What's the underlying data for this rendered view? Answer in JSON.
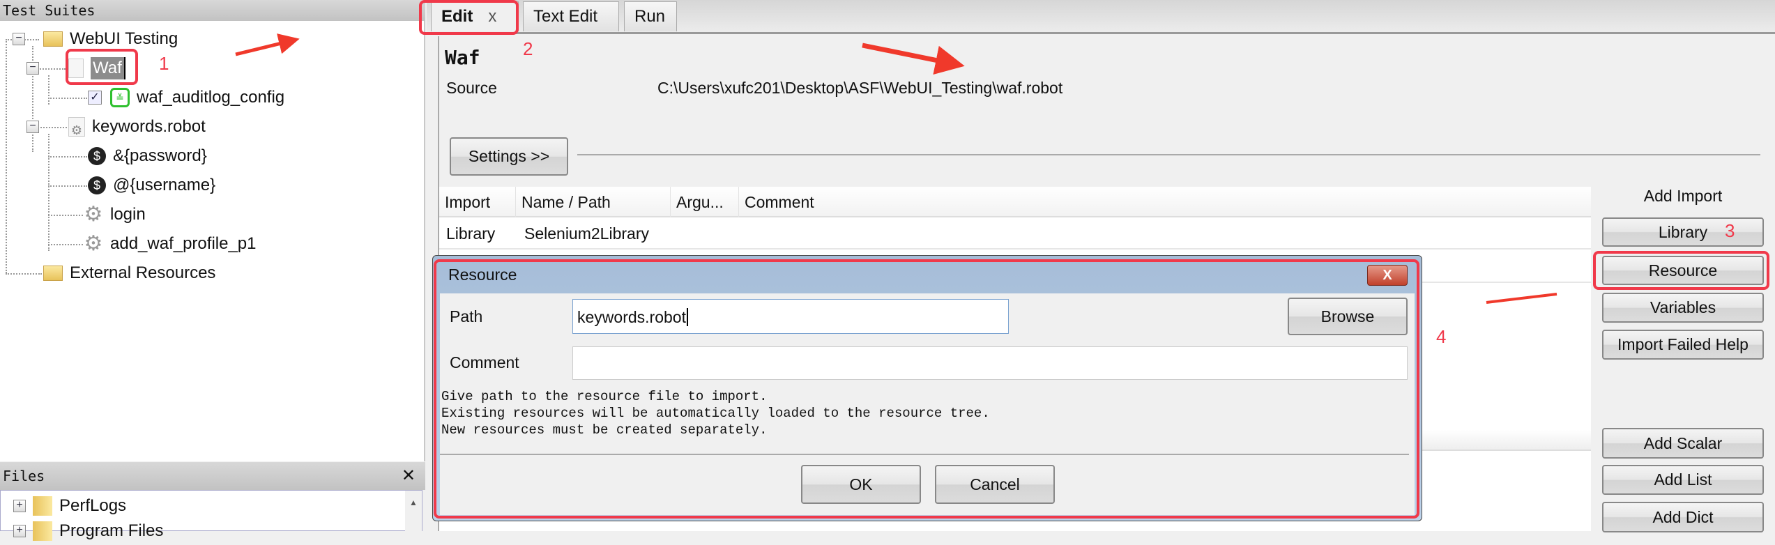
{
  "left_panel": {
    "title": "Test Suites",
    "tree": [
      {
        "label": "WebUI Testing",
        "icon": "folder-icon"
      },
      {
        "label": "Waf",
        "icon": "file-icon",
        "selected": true
      },
      {
        "label": "waf_auditlog_config",
        "icon": "robot-test-icon",
        "checked": true
      },
      {
        "label": "keywords.robot",
        "icon": "resource-file-icon"
      },
      {
        "label": "&{password}",
        "icon": "variable-icon"
      },
      {
        "label": "@{username}",
        "icon": "variable-icon"
      },
      {
        "label": "login",
        "icon": "gear-icon"
      },
      {
        "label": "add_waf_profile_p1",
        "icon": "gear-icon"
      },
      {
        "label": "External Resources",
        "icon": "external-folder-icon"
      }
    ],
    "files": {
      "title": "Files",
      "close": "✕",
      "items": [
        "PerfLogs",
        "Program Files"
      ]
    }
  },
  "tabs": [
    {
      "label": "Edit",
      "close": "x",
      "active": true
    },
    {
      "label": "Text Edit"
    },
    {
      "label": "Run"
    }
  ],
  "editor": {
    "title": "Waf",
    "source_label": "Source",
    "source_path": "C:\\Users\\xufc201\\Desktop\\ASF\\WebUI_Testing\\waf.robot",
    "settings_button": "Settings >>",
    "import_table": {
      "columns": [
        "Import",
        "Name / Path",
        "Argu...",
        "Comment"
      ],
      "rows": [
        [
          "Library",
          "Selenium2Library",
          "",
          ""
        ]
      ]
    },
    "side_buttons": {
      "add_import_label": "Add Import",
      "library": "Library",
      "resource": "Resource",
      "variables": "Variables",
      "import_failed_help": "Import Failed Help",
      "add_scalar": "Add Scalar",
      "add_list": "Add List",
      "add_dict": "Add Dict"
    }
  },
  "dialog": {
    "title": "Resource",
    "close": "X",
    "path_label": "Path",
    "path_value": "keywords.robot",
    "browse": "Browse",
    "comment_label": "Comment",
    "comment_value": "",
    "help": [
      "Give path to the resource file to import.",
      "Existing resources will be automatically loaded to the resource tree.",
      "New resources must be created separately."
    ],
    "ok": "OK",
    "cancel": "Cancel"
  },
  "annotations": [
    "1",
    "2",
    "3",
    "4"
  ],
  "colors": {
    "annotation": "#f0394a",
    "dialog_title": "#a9c1dc",
    "selection": "#8c8c8c"
  }
}
